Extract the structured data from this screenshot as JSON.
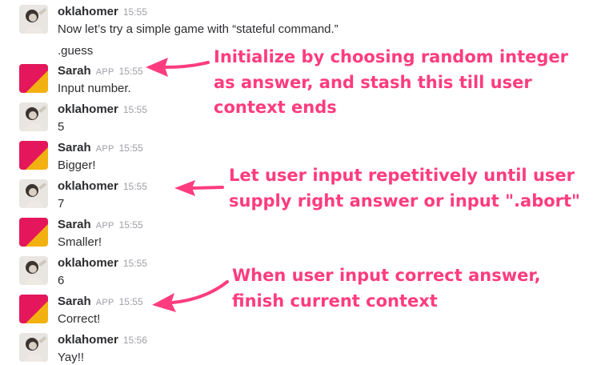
{
  "messages": [
    {
      "kind": "user",
      "name": "oklahomer",
      "time": "15:55",
      "text": "Now let’s try a simple game with “stateful command.”",
      "followup": ".guess"
    },
    {
      "kind": "app",
      "name": "Sarah",
      "tag": "APP",
      "time": "15:55",
      "text": "Input number."
    },
    {
      "kind": "user",
      "name": "oklahomer",
      "time": "15:55",
      "text": "5"
    },
    {
      "kind": "app",
      "name": "Sarah",
      "tag": "APP",
      "time": "15:55",
      "text": "Bigger!"
    },
    {
      "kind": "user",
      "name": "oklahomer",
      "time": "15:55",
      "text": "7"
    },
    {
      "kind": "app",
      "name": "Sarah",
      "tag": "APP",
      "time": "15:55",
      "text": "Smaller!"
    },
    {
      "kind": "user",
      "name": "oklahomer",
      "time": "15:55",
      "text": "6"
    },
    {
      "kind": "app",
      "name": "Sarah",
      "tag": "APP",
      "time": "15:55",
      "text": "Correct!"
    },
    {
      "kind": "user",
      "name": "oklahomer",
      "time": "15:56",
      "text": "Yay!!"
    }
  ],
  "annotations": [
    "Initialize by choosing random integer\nas answer, and stash this till user\ncontext ends",
    "Let user input repetitively until user\nsupply right answer or input \".abort\"",
    "When user input correct answer,\nfinish current context"
  ],
  "colors": {
    "annotation": "#ff3c7e",
    "name": "#2c2d30",
    "meta": "#9e9ea6"
  }
}
